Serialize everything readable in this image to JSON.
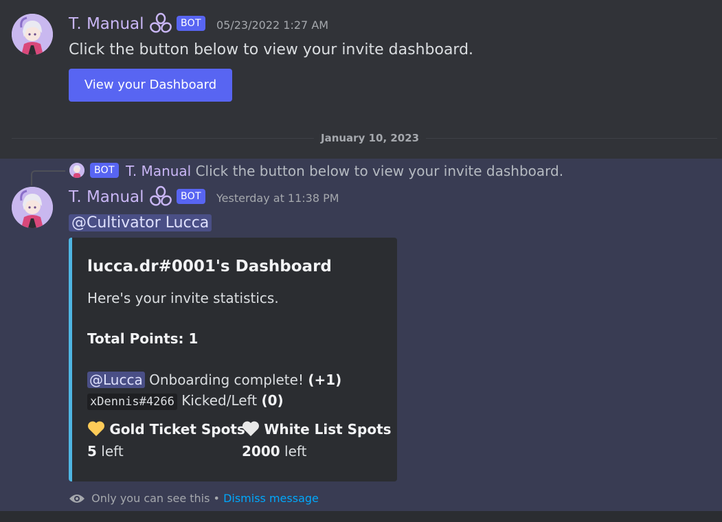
{
  "first_message": {
    "author": "T. Manual",
    "badge": "BOT",
    "timestamp": "05/23/2022 1:27 AM",
    "text": "Click the button below to view your invite dashboard.",
    "button_label": "View your Dashboard"
  },
  "date_divider": "January 10, 2023",
  "reply": {
    "badge": "BOT",
    "author": "T. Manual",
    "text": "Click the button below to view your invite dashboard."
  },
  "second_message": {
    "author": "T. Manual",
    "badge": "BOT",
    "timestamp": "Yesterday at 11:38 PM",
    "mention": "@Cultivator Lucca",
    "embed": {
      "title": "lucca.dr#0001's Dashboard",
      "description": "Here's your invite statistics.",
      "total_points": "Total Points: 1",
      "rows": [
        {
          "user": "@Lucca",
          "user_style": "mention",
          "action": "Onboarding complete!",
          "delta": "(+1)"
        },
        {
          "user": "xDennis#4266",
          "user_style": "code",
          "action": "Kicked/Left",
          "delta": "(0)"
        }
      ],
      "fields": [
        {
          "icon": "yellow-heart-icon",
          "color": "#fdcb58",
          "name": "Gold Ticket Spots",
          "value": "5",
          "suffix": "left"
        },
        {
          "icon": "white-heart-icon",
          "color": "#e8e8e8",
          "name": "White List Spots",
          "value": "2000",
          "suffix": "left"
        }
      ],
      "accent_color": "#4fb6e3"
    },
    "footer": {
      "visibility": "Only you can see this",
      "separator": "•",
      "dismiss": "Dismiss message"
    }
  }
}
